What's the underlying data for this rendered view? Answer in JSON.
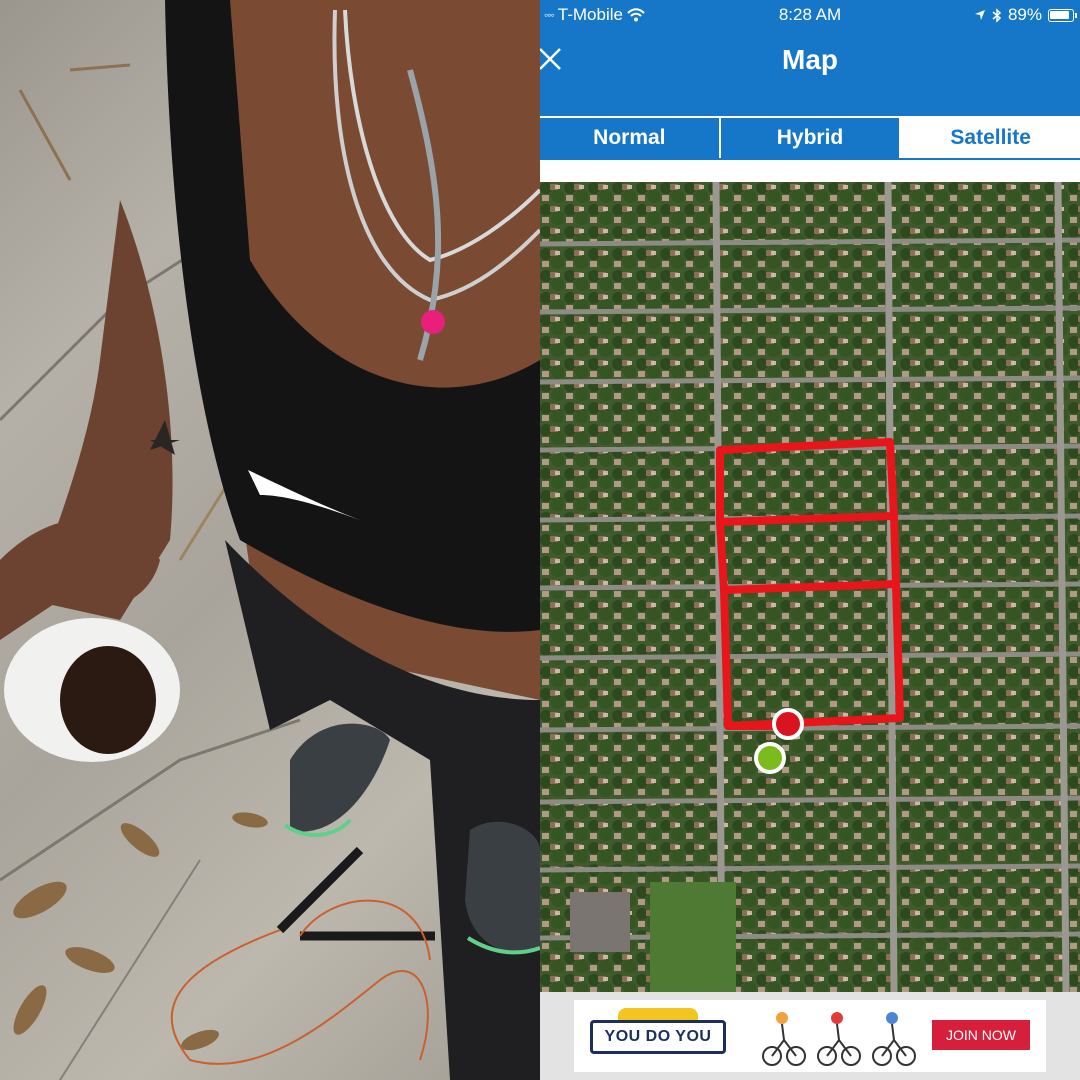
{
  "status_bar": {
    "carrier_dots": "◦◦◦",
    "carrier": "T-Mobile",
    "time": "8:28 AM",
    "battery": "89%",
    "icons": [
      "signal-dots-icon",
      "wifi-icon",
      "location-arrow-icon",
      "bluetooth-icon",
      "battery-icon"
    ]
  },
  "navbar": {
    "title": "Map",
    "close_icon": "close-icon"
  },
  "segments": {
    "items": [
      {
        "label": "Normal",
        "active": false
      },
      {
        "label": "Hybrid",
        "active": false
      },
      {
        "label": "Satellite",
        "active": true
      }
    ]
  },
  "map": {
    "route_color": "#e8161b",
    "end_marker_color": "#d9141e",
    "start_marker_color": "#7bbb1c"
  },
  "ad": {
    "logo_text": "YOU DO YOU",
    "cta": "JOIN NOW",
    "cta_color": "#d61f3b"
  },
  "colors": {
    "accent": "#1677c9"
  }
}
